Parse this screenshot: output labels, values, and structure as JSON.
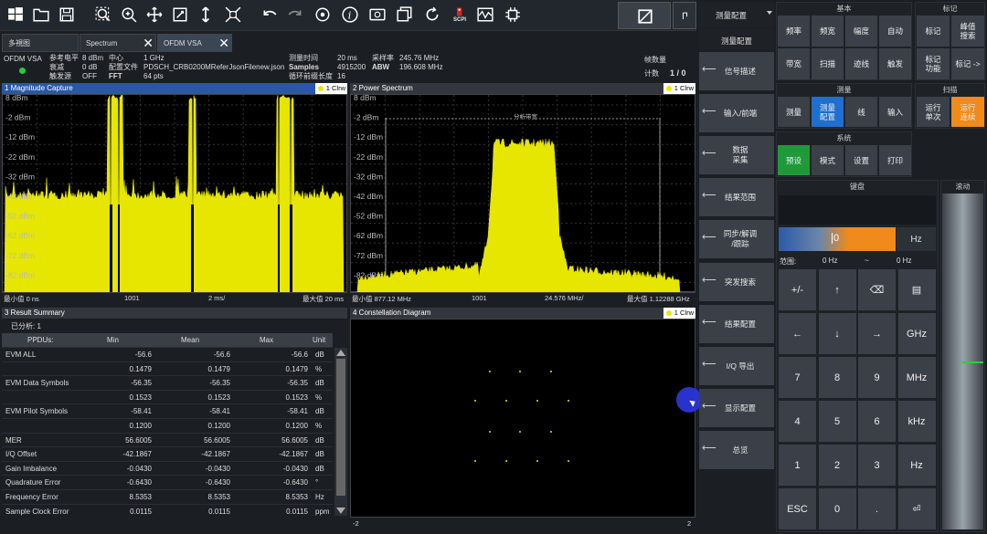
{
  "toolbar": {
    "icons": [
      "windows-icon",
      "open-folder-icon",
      "save-icon",
      "zoom-fit-icon",
      "zoom-in-icon",
      "pan-move-icon",
      "zoom-box-icon",
      "vertical-zoom-icon",
      "fit-all-icon",
      "undo-icon",
      "redo-icon",
      "refresh-target-icon",
      "info-icon",
      "screenshot-icon",
      "windows-copy-icon",
      "rotate-icon",
      "scpi-icon",
      "waveform-icon",
      "chip-icon"
    ],
    "scpi_label": "SCPI"
  },
  "tabs": [
    {
      "label": "多視图"
    },
    {
      "label": "Spectrum"
    },
    {
      "label": "OFDM VSA"
    }
  ],
  "info": {
    "mode": "OFDM VSA",
    "ref_level_label": "参考电平",
    "ref_level": "8 dBm",
    "center_label": "中心",
    "center": "1 GHz",
    "capture_time_label": "测量时间",
    "capture_time": "20 ms",
    "sample_rate_label": "采样率",
    "sample_rate": "245.76 MHz",
    "att_label": "衰减",
    "att": "0 dB",
    "config_label": "配置文件",
    "config": "PDSCH_CRB0200MReferJsonFilenew.json",
    "samples_label": "Samples",
    "samples": "4915200",
    "abw_label": "ABW",
    "abw": "196.608 MHz",
    "trigger_label": "触发源",
    "trigger": "OFF",
    "fft_label": "FFT",
    "fft": "64 pts",
    "cp_label": "循环前缀长度",
    "cp": "16",
    "frames_label": "帧数量",
    "count_label": "计数",
    "count": "1 / 0"
  },
  "panel1": {
    "title": "1 Magnitude Capture",
    "badge": "1 Clrw",
    "y_ticks": [
      "8 dBm",
      "-2 dBm",
      "-12 dBm",
      "-22 dBm",
      "-32 dBm",
      "-42 dBm",
      "-52 dBm",
      "-62 dBm",
      "-72 dBm",
      "-82 dBm"
    ],
    "foot_left": "最小值 0 ns",
    "foot_mid": "1001",
    "foot_unit": "2 ms/",
    "foot_right": "最大值 20 ms"
  },
  "panel2": {
    "title": "2 Power Spectrum",
    "badge": "1 Clrw",
    "y_ticks": [
      "8 dBm",
      "-2 dBm",
      "-12 dBm",
      "-22 dBm",
      "-32 dBm",
      "-42 dBm",
      "-52 dBm",
      "-62 dBm",
      "-72 dBm",
      "-82 dBm",
      "-92 dBm"
    ],
    "band_label": "分析带宽",
    "foot_left": "最小值 877.12 MHz",
    "foot_mid": "1001",
    "foot_unit": "24.576 MHz/",
    "foot_right": "最大值 1.12288 GHz"
  },
  "panel3": {
    "title": "3 Result Summary",
    "analyzed": "已分析:  1",
    "headers": [
      "PPDUs:",
      "Min",
      "Mean",
      "Max",
      "Unit"
    ],
    "rows": [
      [
        "EVM ALL",
        "-56.6",
        "-56.6",
        "-56.6",
        "dB"
      ],
      [
        "",
        "0.1479",
        "0.1479",
        "0.1479",
        "%"
      ],
      [
        "EVM Data Symbols",
        "-56.35",
        "-56.35",
        "-56.35",
        "dB"
      ],
      [
        "",
        "0.1523",
        "0.1523",
        "0.1523",
        "%"
      ],
      [
        "EVM Pilot Symbols",
        "-58.41",
        "-58.41",
        "-58.41",
        "dB"
      ],
      [
        "",
        "0.1200",
        "0.1200",
        "0.1200",
        "%"
      ],
      [
        "MER",
        "56.6005",
        "56.6005",
        "56.6005",
        "dB"
      ],
      [
        "I/Q Offset",
        "-42.1867",
        "-42.1867",
        "-42.1867",
        "dB"
      ],
      [
        "Gain Imbalance",
        "-0.0430",
        "-0.0430",
        "-0.0430",
        "dB"
      ],
      [
        "Quadrature Error",
        "-0.6430",
        "-0.6430",
        "-0.6430",
        "°"
      ],
      [
        "Frequency Error",
        "8.5353",
        "8.5353",
        "8.5353",
        "Hz"
      ],
      [
        "Sample Clock Error",
        "0.0115",
        "0.0115",
        "0.0115",
        "ppm"
      ]
    ]
  },
  "panel4": {
    "title": "4 Constellation Diagram",
    "badge": "1 Clrw",
    "foot_left": "-2",
    "foot_right": "2"
  },
  "menu": {
    "title": "测量配置",
    "subtitle": "测量配置",
    "items": [
      "信号描述",
      "输入/前端",
      "数据\n采集",
      "结果范围",
      "同步/解调\n/跟踪",
      "突发搜索",
      "结果配置",
      "I/Q 导出",
      "显示配置",
      "总览"
    ]
  },
  "basic": {
    "title": "基本",
    "keys": [
      "频率",
      "频宽",
      "幅度",
      "自动",
      "带宽",
      "扫描",
      "迹线",
      "触发"
    ]
  },
  "marker": {
    "title": "标记",
    "keys": [
      "标记",
      "峰值\n搜索",
      "标记\n功能",
      "标记 ->"
    ]
  },
  "measure": {
    "title": "测量",
    "keys": [
      "测量",
      "测量\n配置",
      "线",
      "输入"
    ]
  },
  "sweep": {
    "title": "扫描",
    "keys": [
      "运行\n单次",
      "运行\n连续"
    ]
  },
  "system": {
    "title": "系统",
    "keys": [
      "预设",
      "模式",
      "设置",
      "打印"
    ]
  },
  "keyboard": {
    "title": "键盘",
    "input_value": "0",
    "unit": "Hz",
    "range_label": "范围:",
    "range_min": "0 Hz",
    "range_sep": "~",
    "range_max": "0 Hz",
    "keys": [
      "+/-",
      "↑",
      "⌫",
      "▤",
      "←",
      "↓",
      "→",
      "GHz",
      "7",
      "8",
      "9",
      "MHz",
      "4",
      "5",
      "6",
      "kHz",
      "1",
      "2",
      "3",
      "Hz",
      "ESC",
      "0",
      ".",
      "⏎"
    ]
  },
  "scroll": {
    "title": "滚动"
  },
  "colors": {
    "accent": "#2d56a7",
    "trace": "#e6e600",
    "orange": "#f08a1a",
    "green": "#1f9a3a"
  }
}
